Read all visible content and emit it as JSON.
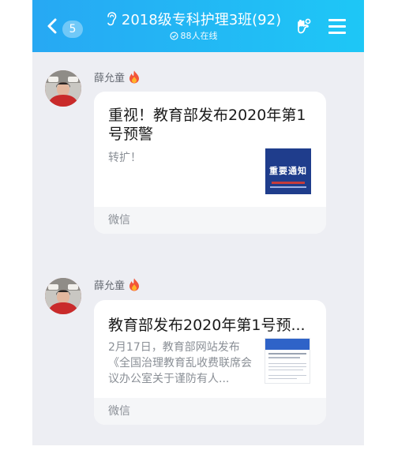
{
  "header": {
    "unread_count": "5",
    "group_title": "2018级专科护理3班(92)",
    "online_status": "88人在线",
    "colors": {
      "gradient_start": "#27a8f3",
      "gradient_end": "#1ec7f6"
    }
  },
  "messages": [
    {
      "sender": "薛允童",
      "card": {
        "title": "重视！教育部发布2020年第1号预警",
        "description": "转扩！",
        "thumbnail_text": "重要通知",
        "source": "微信"
      }
    },
    {
      "sender": "薛允童",
      "card": {
        "title": "教育部发布2020年第1号预...",
        "description": "2月17日，教育部网站发布《全国治理教育乱收费联席会议办公室关于谨防有人...",
        "source": "微信"
      }
    }
  ]
}
